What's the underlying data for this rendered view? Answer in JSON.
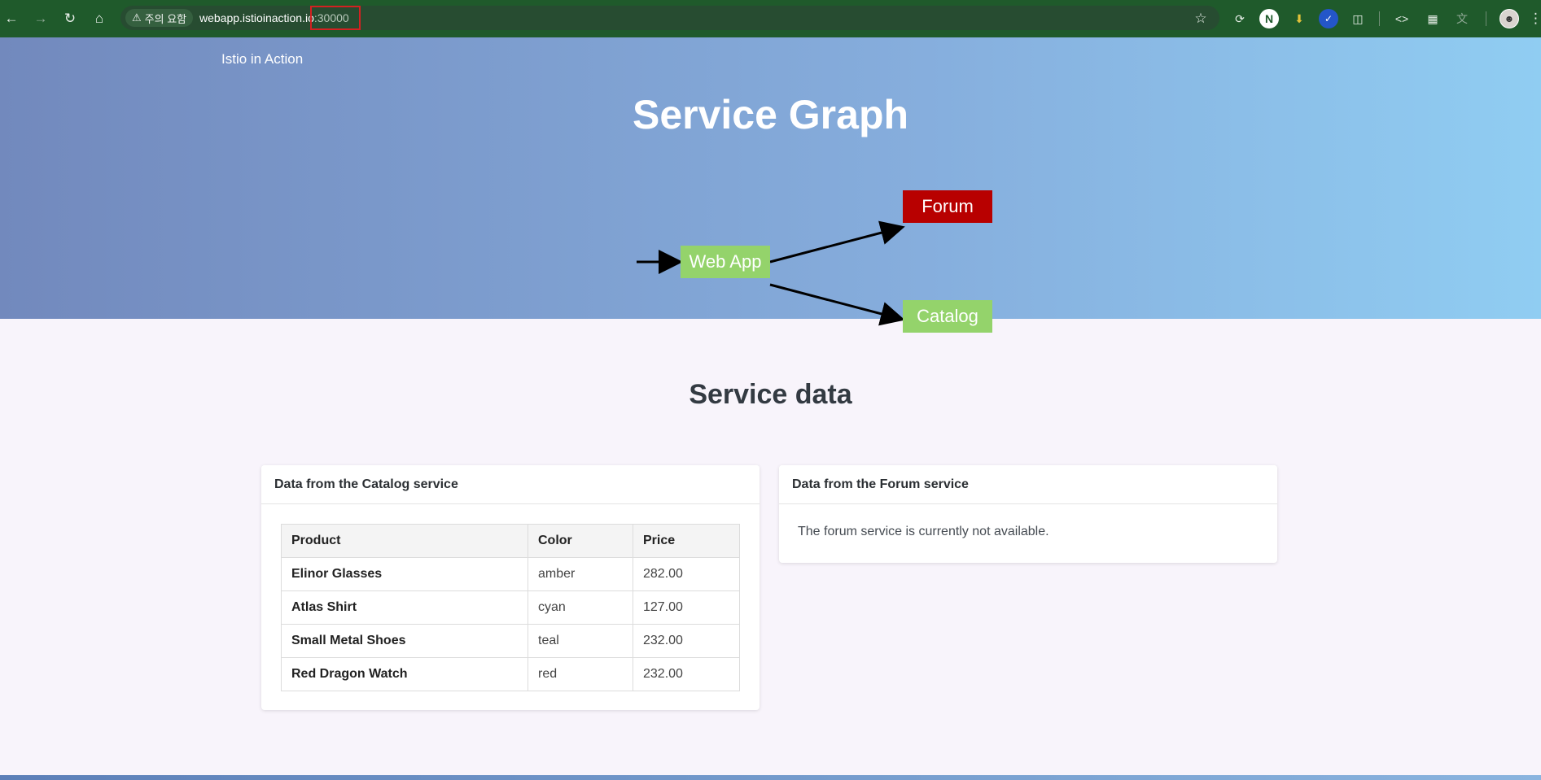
{
  "browser": {
    "security_chip": "주의 요함",
    "url_host": "webapp.istioinaction.io",
    "url_port": ":30000"
  },
  "hero": {
    "brand": "Istio in Action",
    "title": "Service Graph",
    "graph": {
      "nodes": {
        "webapp": "Web App",
        "forum": "Forum",
        "catalog": "Catalog"
      },
      "colors": {
        "up": "#94d36b",
        "down": "#b80000"
      }
    }
  },
  "main": {
    "section_title": "Service data",
    "catalog_card": {
      "title": "Data from the Catalog service",
      "columns": [
        "Product",
        "Color",
        "Price"
      ],
      "rows": [
        {
          "product": "Elinor Glasses",
          "color": "amber",
          "price": "282.00"
        },
        {
          "product": "Atlas Shirt",
          "color": "cyan",
          "price": "127.00"
        },
        {
          "product": "Small Metal Shoes",
          "color": "teal",
          "price": "232.00"
        },
        {
          "product": "Red Dragon Watch",
          "color": "red",
          "price": "232.00"
        }
      ]
    },
    "forum_card": {
      "title": "Data from the Forum service",
      "message": "The forum service is currently not available."
    }
  },
  "icons": [
    "back-arrow-icon",
    "forward-arrow-icon",
    "reload-icon",
    "home-icon",
    "warning-icon",
    "star-icon",
    "extension-icon",
    "code-icon",
    "layout-icon",
    "translate-icon",
    "menu-icon"
  ]
}
